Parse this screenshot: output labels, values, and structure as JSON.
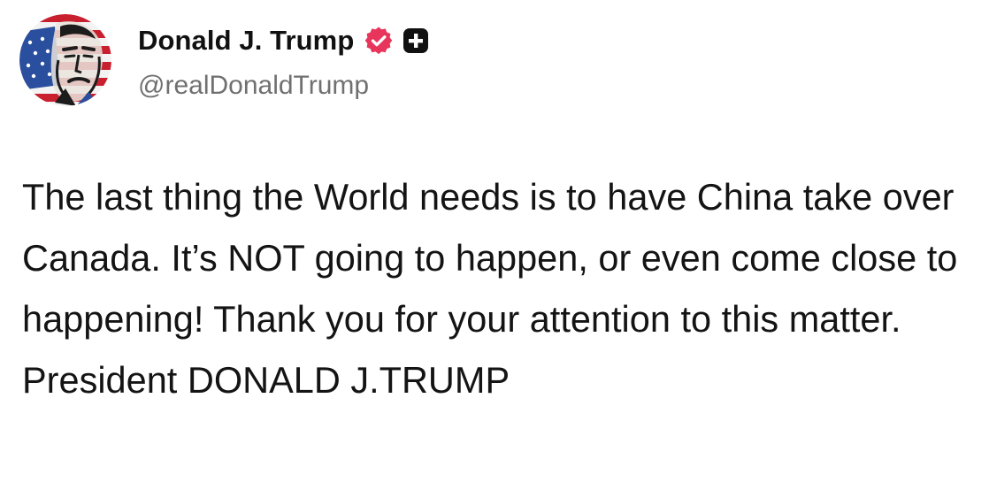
{
  "post": {
    "author": {
      "display_name": "Donald J. Trump",
      "handle": "@realDonaldTrump",
      "verified_icon": "verified-badge-icon",
      "plus_icon": "plus-badge-icon",
      "colors": {
        "verified": "#e8355b",
        "plus_badge": "#111111"
      }
    },
    "text": "The last thing the World needs is to have China take over Canada. It’s NOT going to happen, or even come close to happening! Thank you for your attention to this matter. President DONALD J.TRUMP"
  }
}
